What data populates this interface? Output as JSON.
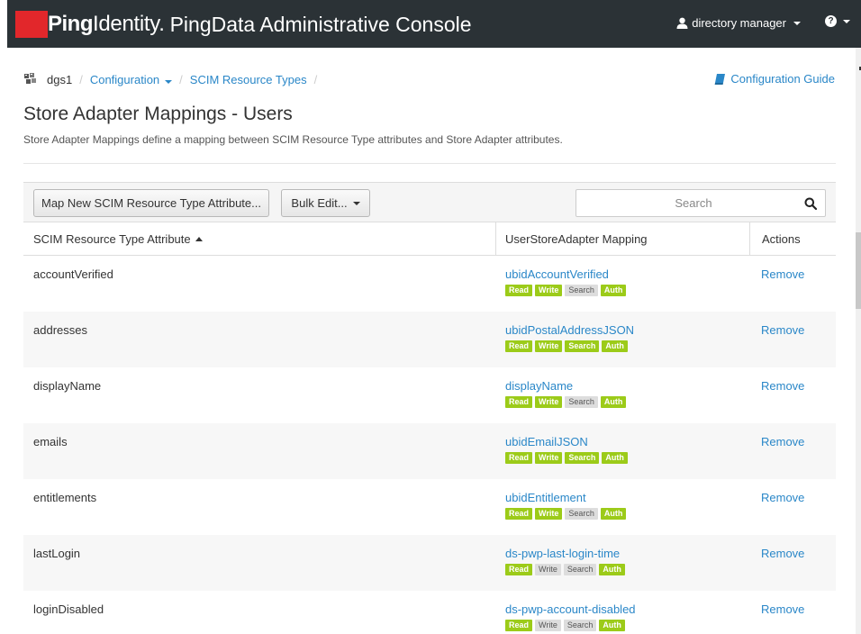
{
  "header": {
    "brand_ping": "Ping",
    "brand_identity": "Identity.",
    "console_title": "PingData Administrative Console",
    "user_label": "directory manager",
    "brand_color": "#e2272b",
    "bar_color": "#2b3236"
  },
  "breadcrumb": {
    "server": "dgs1",
    "configuration": "Configuration",
    "scim_resource_types": "SCIM Resource Types",
    "separator": "/"
  },
  "guide_link": "Configuration Guide",
  "page": {
    "title": "Store Adapter Mappings - Users",
    "description": "Store Adapter Mappings define a mapping between SCIM Resource Type attributes and Store Adapter attributes."
  },
  "toolbar": {
    "map_new_label": "Map New SCIM Resource Type Attribute...",
    "bulk_edit_label": "Bulk Edit...",
    "search_placeholder": "Search"
  },
  "table": {
    "headers": {
      "attribute": "SCIM Resource Type Attribute",
      "mapping": "UserStoreAdapter Mapping",
      "actions": "Actions"
    },
    "badge_labels": [
      "Read",
      "Write",
      "Search",
      "Auth"
    ],
    "badge_on_color": "#9ccb19",
    "rows": [
      {
        "attribute": "accountVerified",
        "mapping": "ubidAccountVerified",
        "action": "Remove",
        "flags": [
          true,
          true,
          false,
          true
        ]
      },
      {
        "attribute": "addresses",
        "mapping": "ubidPostalAddressJSON",
        "action": "Remove",
        "flags": [
          true,
          true,
          true,
          true
        ]
      },
      {
        "attribute": "displayName",
        "mapping": "displayName",
        "action": "Remove",
        "flags": [
          true,
          true,
          false,
          true
        ]
      },
      {
        "attribute": "emails",
        "mapping": "ubidEmailJSON",
        "action": "Remove",
        "flags": [
          true,
          true,
          true,
          true
        ]
      },
      {
        "attribute": "entitlements",
        "mapping": "ubidEntitlement",
        "action": "Remove",
        "flags": [
          true,
          true,
          false,
          true
        ]
      },
      {
        "attribute": "lastLogin",
        "mapping": "ds-pwp-last-login-time",
        "action": "Remove",
        "flags": [
          true,
          false,
          false,
          true
        ]
      },
      {
        "attribute": "loginDisabled",
        "mapping": "ds-pwp-account-disabled",
        "action": "Remove",
        "flags": [
          true,
          false,
          false,
          true
        ]
      }
    ]
  },
  "icons": {
    "user": "user-icon",
    "help": "question-circle-icon",
    "server": "server-cluster-icon",
    "book": "book-icon",
    "search": "search-icon"
  }
}
